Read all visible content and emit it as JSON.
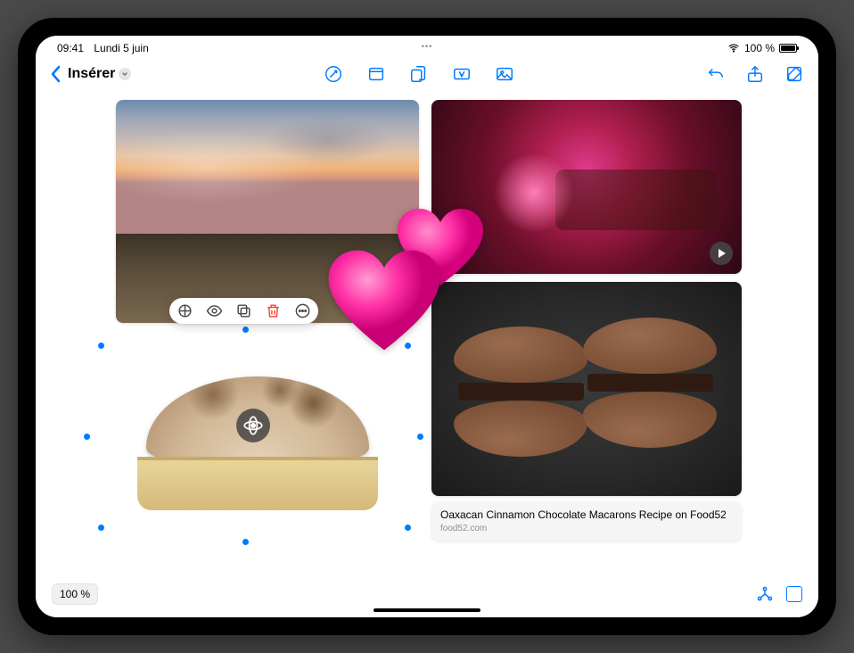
{
  "status": {
    "time": "09:41",
    "date": "Lundi 5 juin",
    "battery": "100 %"
  },
  "toolbar": {
    "title": "Insérer"
  },
  "link": {
    "title": "Oaxacan Cinnamon Chocolate Macarons Recipe on Food52",
    "domain": "food52.com"
  },
  "zoom": {
    "label": "100 %"
  },
  "icons": {
    "markup": "markup-icon",
    "note": "note-icon",
    "attach": "attach-icon",
    "textbox": "textbox-icon",
    "photos": "photos-icon",
    "undo": "undo-icon",
    "share": "share-icon",
    "compose": "compose-icon"
  }
}
